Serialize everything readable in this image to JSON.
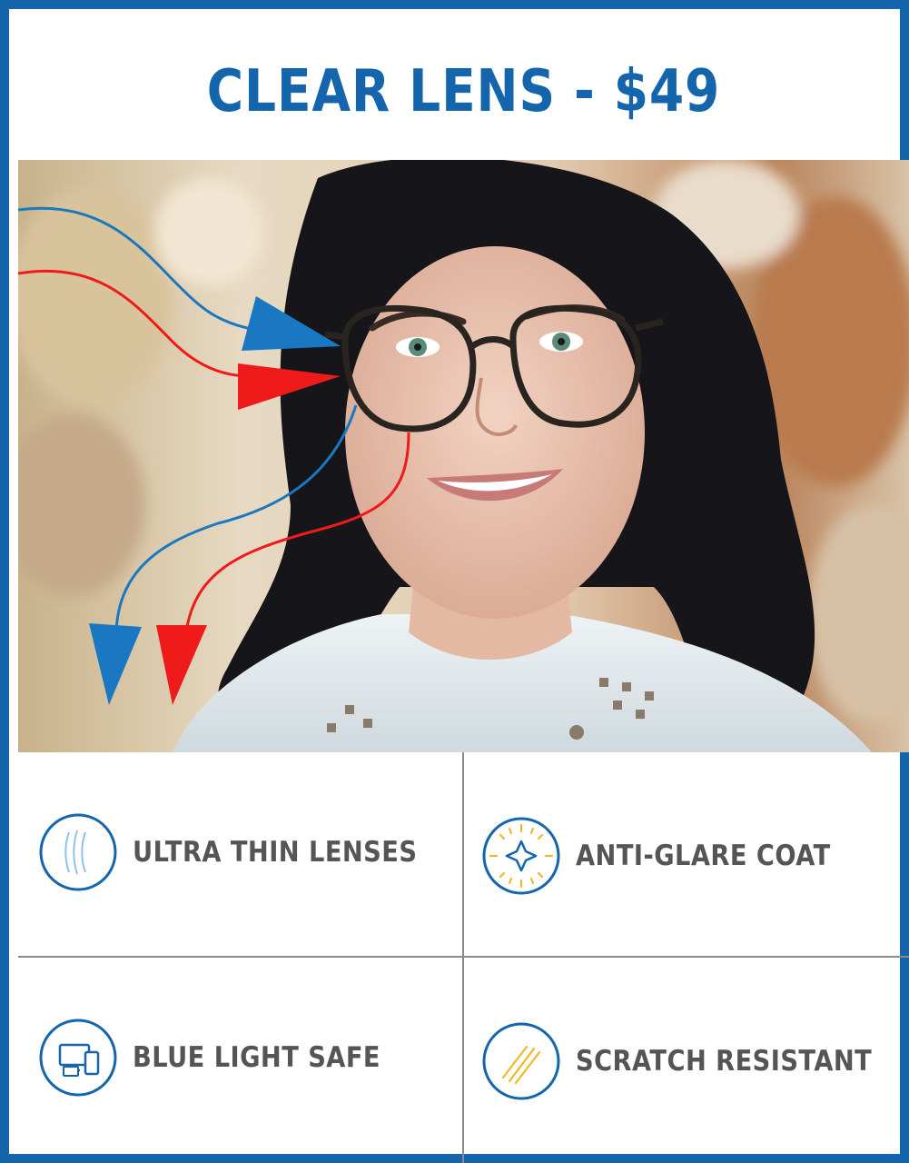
{
  "header": {
    "title": "CLEAR LENS - $49"
  },
  "colors": {
    "brand_blue": "#1565ad",
    "ray_blue": "#1a78c2",
    "ray_red": "#ef1b1b",
    "accent_yellow": "#f2b21b",
    "label_gray": "#555555"
  },
  "photo": {
    "description_icon": "woman-wearing-glasses-photo",
    "rays": [
      "blue-light-ray",
      "uv-red-ray"
    ]
  },
  "features": [
    {
      "label": "ULTRA THIN LENSES",
      "icon": "thin-lens-icon"
    },
    {
      "label": "ANTI-GLARE COAT",
      "icon": "sparkle-icon"
    },
    {
      "label": "BLUE LIGHT SAFE",
      "icon": "devices-icon"
    },
    {
      "label": "SCRATCH RESISTANT",
      "icon": "scratch-icon"
    }
  ]
}
